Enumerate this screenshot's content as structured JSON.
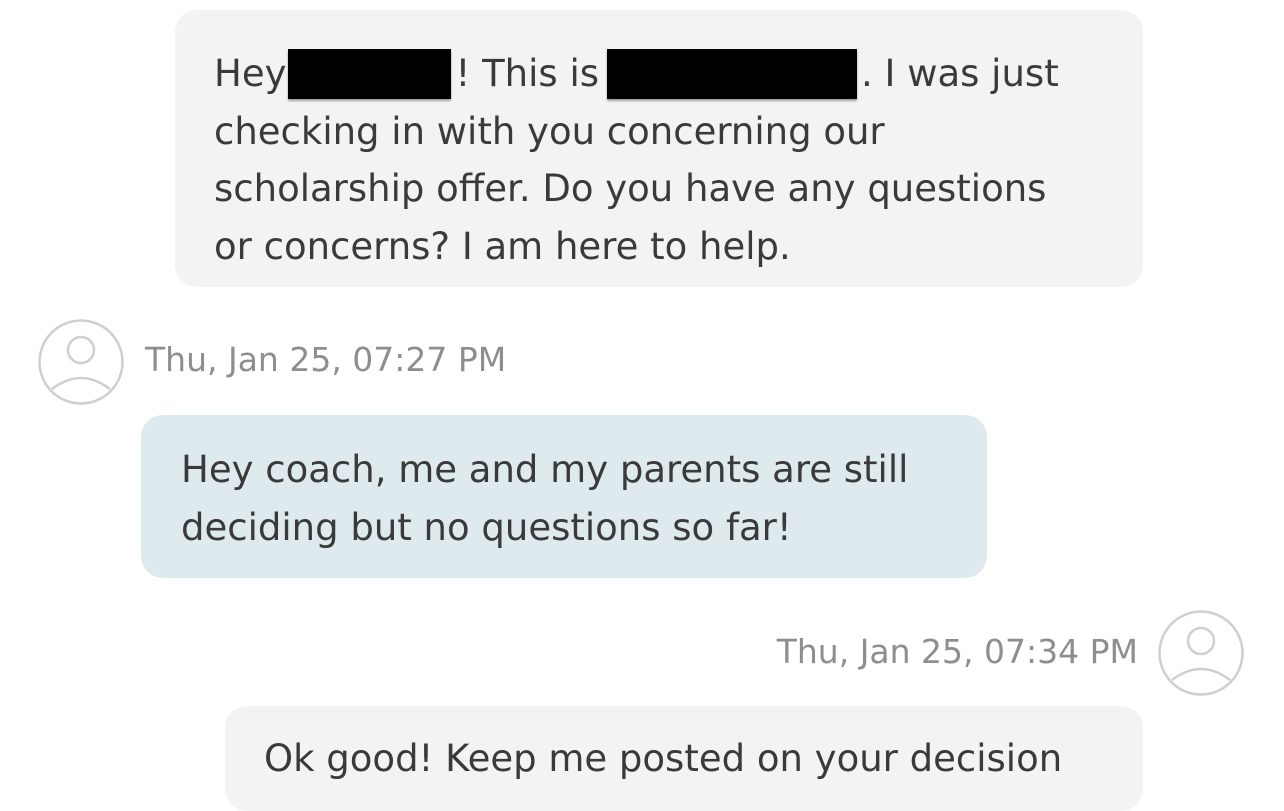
{
  "thread": {
    "message_1": {
      "part_a": "Hey",
      "part_b": "! This is",
      "part_c": ". I was just",
      "line_2": "checking in with you concerning our",
      "line_3": "scholarship offer. Do you have any questions",
      "line_4": "or concerns? I am here to help."
    },
    "message_2": {
      "timestamp": "Thu, Jan 25, 07:27 PM",
      "line_1": "Hey coach, me and my parents are still",
      "line_2": "deciding but no questions so far!"
    },
    "message_3": {
      "timestamp": "Thu, Jan 25, 07:34 PM",
      "line_1": "Ok good! Keep me posted on your decision"
    }
  },
  "icons": {
    "avatar": "user-avatar-icon",
    "redaction": "redaction-bar"
  },
  "colors": {
    "incoming_bubble": "#f3f3f3",
    "outgoing_bubble": "#dfeaee",
    "timestamp_text": "#8e8e8e",
    "message_text": "#3a3a3a"
  }
}
